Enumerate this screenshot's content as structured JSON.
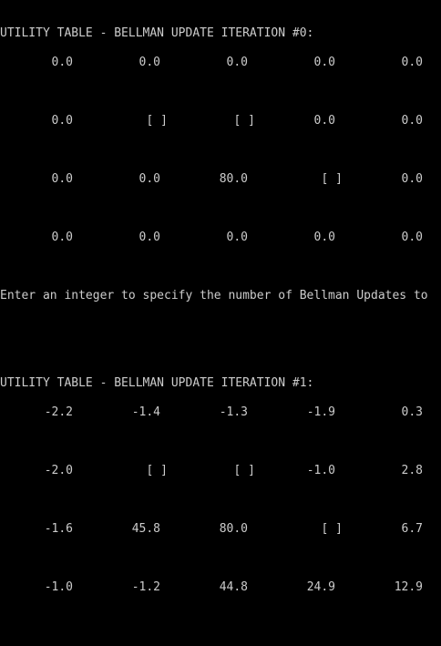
{
  "window": {
    "background": "#000000",
    "text_color": "#cccccc"
  },
  "tables": [
    {
      "title": "UTILITY TABLE - BELLMAN UPDATE ITERATION #0:",
      "rows": [
        [
          "0.0",
          "0.0",
          "0.0",
          "0.0",
          "0.0"
        ],
        [
          "0.0",
          "[ ]",
          "[ ]",
          "0.0",
          "0.0"
        ],
        [
          "0.0",
          "0.0",
          "80.0",
          "[ ]",
          "0.0"
        ],
        [
          "0.0",
          "0.0",
          "0.0",
          "0.0",
          "0.0"
        ]
      ]
    },
    {
      "title": "UTILITY TABLE - BELLMAN UPDATE ITERATION #1:",
      "rows": [
        [
          "-2.2",
          "-1.4",
          "-1.3",
          "-1.9",
          "0.3"
        ],
        [
          "-2.0",
          "[ ]",
          "[ ]",
          "-1.0",
          "2.8"
        ],
        [
          "-1.6",
          "45.8",
          "80.0",
          "[ ]",
          "6.7"
        ],
        [
          "-1.0",
          "-1.2",
          "44.8",
          "24.9",
          "12.9"
        ]
      ]
    }
  ],
  "prompt": "Enter an integer to specify the number of Bellman Updates to"
}
